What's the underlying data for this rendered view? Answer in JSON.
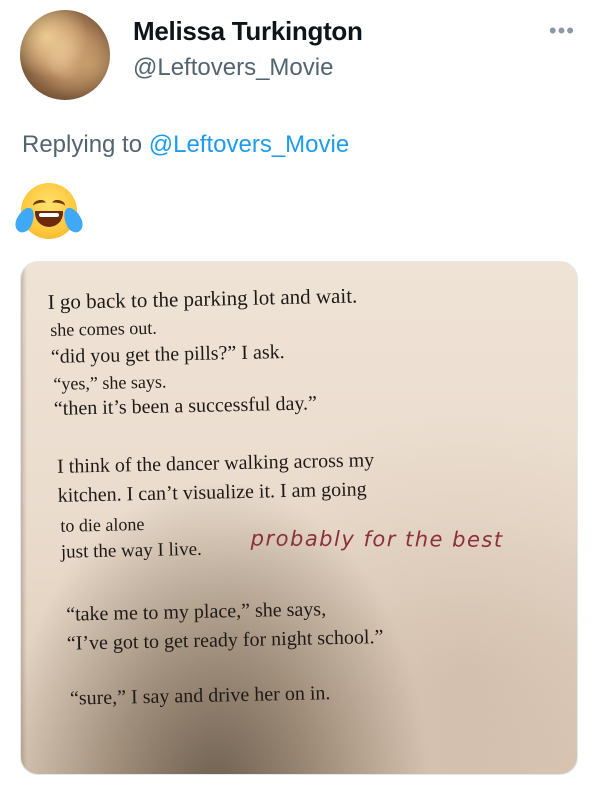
{
  "tweet": {
    "author_name": "Melissa Turkington",
    "author_handle": "@Leftovers_Movie",
    "more_label": "•••",
    "replying_prefix": "Replying to",
    "replying_mention": "@Leftovers_Movie",
    "emoji": "face-with-tears-of-joy"
  },
  "photo": {
    "book_lines": [
      "I go back to the parking lot and wait.",
      "she comes out.",
      "“did you get the pills?” I ask.",
      "“yes,” she says.",
      "“then it’s been a successful day.”",
      "I think of the dancer walking across my",
      "kitchen. I can’t visualize it. I am going",
      "to die alone",
      "just the way I live.",
      "“take me to my place,” she says,",
      "“I’ve got to get ready for night school.”",
      "“sure,” I say and drive her on in."
    ],
    "handwritten_note": "probably for the best",
    "colors": {
      "ink": "#1f1a17",
      "annotation": "#8b2f3a",
      "paper": "#ece0d2"
    }
  }
}
